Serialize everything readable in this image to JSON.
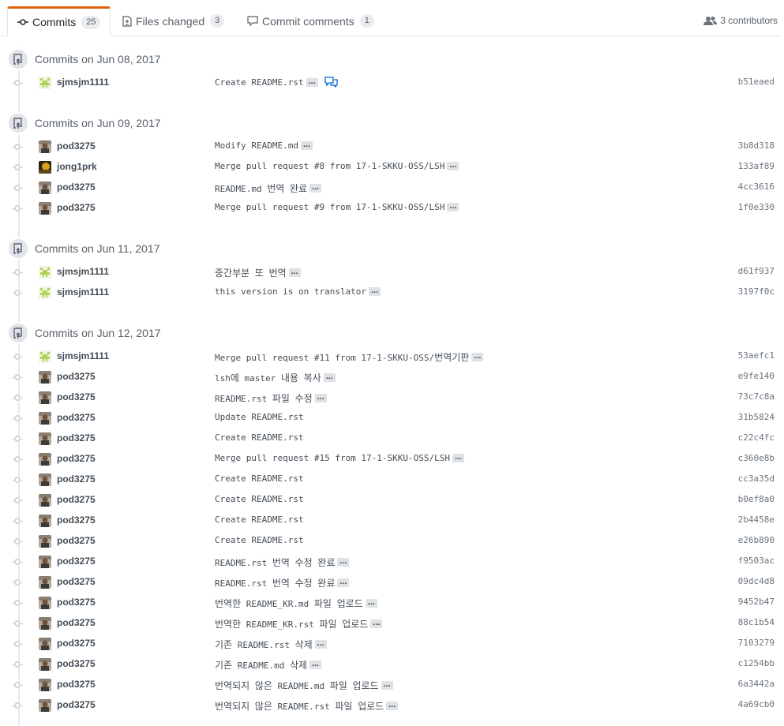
{
  "tabs": {
    "commits": {
      "label": "Commits",
      "count": "25"
    },
    "files": {
      "label": "Files changed",
      "count": "3"
    },
    "comments": {
      "label": "Commit comments",
      "count": "1"
    }
  },
  "contributors": "3 contributors",
  "groups": [
    {
      "title": "Commits on Jun 08, 2017",
      "commits": [
        {
          "author": "sjmsjm1111",
          "avatar": "green",
          "message": "Create README.rst",
          "ellipsis": true,
          "comment": true,
          "sha": "b51eaed"
        }
      ]
    },
    {
      "title": "Commits on Jun 09, 2017",
      "commits": [
        {
          "author": "pod3275",
          "avatar": "photo",
          "message": "Modify README.md",
          "ellipsis": true,
          "sha": "3b8d318"
        },
        {
          "author": "jong1prk",
          "avatar": "dark",
          "message": "Merge pull request #8 from 17-1-SKKU-OSS/LSH",
          "ellipsis": true,
          "sha": "133af89"
        },
        {
          "author": "pod3275",
          "avatar": "photo",
          "message": "README.md 번역 완료",
          "ellipsis": true,
          "sha": "4cc3616"
        },
        {
          "author": "pod3275",
          "avatar": "photo",
          "message": "Merge pull request #9 from 17-1-SKKU-OSS/LSH",
          "ellipsis": true,
          "sha": "1f0e330"
        }
      ]
    },
    {
      "title": "Commits on Jun 11, 2017",
      "commits": [
        {
          "author": "sjmsjm1111",
          "avatar": "green",
          "message": "중간부분 또 번역",
          "ellipsis": true,
          "sha": "d61f937"
        },
        {
          "author": "sjmsjm1111",
          "avatar": "green",
          "message": "this version is on translator",
          "ellipsis": true,
          "sha": "3197f0c"
        }
      ]
    },
    {
      "title": "Commits on Jun 12, 2017",
      "commits": [
        {
          "author": "sjmsjm1111",
          "avatar": "green",
          "message": "Merge pull request #11 from 17-1-SKKU-OSS/번역기판",
          "ellipsis": true,
          "sha": "53aefc1"
        },
        {
          "author": "pod3275",
          "avatar": "photo",
          "message": "lsh에 master 내용 복사",
          "ellipsis": true,
          "sha": "e9fe140"
        },
        {
          "author": "pod3275",
          "avatar": "photo",
          "message": "README.rst 파일 수정",
          "ellipsis": true,
          "sha": "73c7c8a"
        },
        {
          "author": "pod3275",
          "avatar": "photo",
          "message": "Update README.rst",
          "ellipsis": false,
          "sha": "31b5824"
        },
        {
          "author": "pod3275",
          "avatar": "photo",
          "message": "Create README.rst",
          "ellipsis": false,
          "sha": "c22c4fc"
        },
        {
          "author": "pod3275",
          "avatar": "photo",
          "message": "Merge pull request #15 from 17-1-SKKU-OSS/LSH",
          "ellipsis": true,
          "sha": "c360e8b"
        },
        {
          "author": "pod3275",
          "avatar": "photo",
          "message": "Create README.rst",
          "ellipsis": false,
          "sha": "cc3a35d"
        },
        {
          "author": "pod3275",
          "avatar": "photo",
          "message": "Create README.rst",
          "ellipsis": false,
          "sha": "b0ef8a0"
        },
        {
          "author": "pod3275",
          "avatar": "photo",
          "message": "Create README.rst",
          "ellipsis": false,
          "sha": "2b4458e"
        },
        {
          "author": "pod3275",
          "avatar": "photo",
          "message": "Create README.rst",
          "ellipsis": false,
          "sha": "e26b890"
        },
        {
          "author": "pod3275",
          "avatar": "photo",
          "message": "README.rst 번역 수정 완료",
          "ellipsis": true,
          "sha": "f9503ac"
        },
        {
          "author": "pod3275",
          "avatar": "photo",
          "message": "README.rst 번역 수정 완료",
          "ellipsis": true,
          "sha": "09dc4d8"
        },
        {
          "author": "pod3275",
          "avatar": "photo",
          "message": "번역한 README_KR.md 파일 업로드",
          "ellipsis": true,
          "sha": "9452b47"
        },
        {
          "author": "pod3275",
          "avatar": "photo",
          "message": "번역한 README_KR.rst 파일 업로드",
          "ellipsis": true,
          "sha": "88c1b54"
        },
        {
          "author": "pod3275",
          "avatar": "photo",
          "message": "기존 README.rst 삭제",
          "ellipsis": true,
          "sha": "7103279"
        },
        {
          "author": "pod3275",
          "avatar": "photo",
          "message": "기존 README.md 삭제",
          "ellipsis": true,
          "sha": "c1254bb"
        },
        {
          "author": "pod3275",
          "avatar": "photo",
          "message": "번역되지 않은 README.md 파일 업로드",
          "ellipsis": true,
          "sha": "6a3442a"
        },
        {
          "author": "pod3275",
          "avatar": "photo",
          "message": "번역되지 않은 README.rst 파일 업로드",
          "ellipsis": true,
          "sha": "4a69cb0"
        }
      ]
    }
  ],
  "colors": {
    "accent": "#e36209",
    "muted": "#586069",
    "line": "#e8eaed"
  },
  "icons": {
    "commits_tab": "git-commit-icon",
    "files_tab": "file-diff-icon",
    "comments_tab": "comment-icon",
    "contributors": "people-icon",
    "group": "repo-push-icon"
  }
}
